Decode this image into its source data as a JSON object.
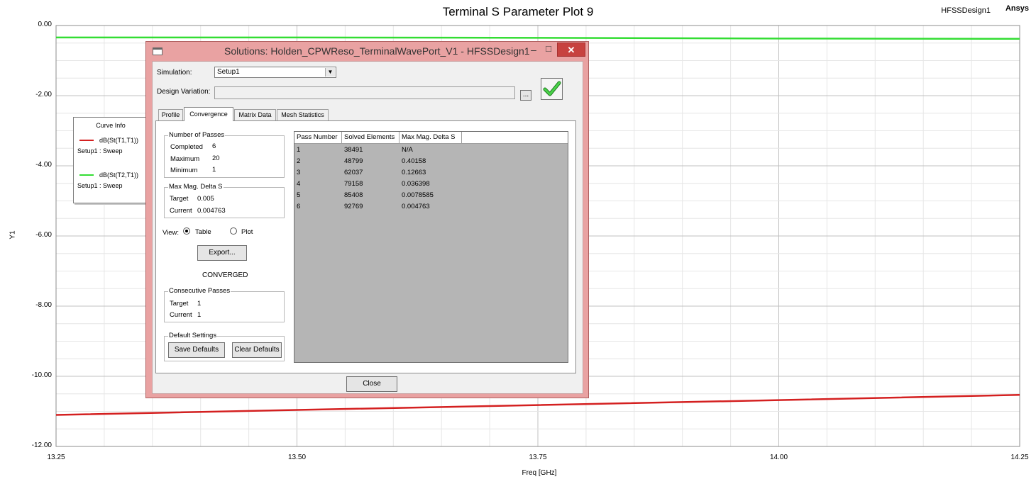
{
  "plot": {
    "title": "Terminal S Parameter Plot 9",
    "design": "HFSSDesign1",
    "brand": "Ansys",
    "xlabel": "Freq [GHz]",
    "ylabel": "Y1"
  },
  "chart_data": {
    "type": "line",
    "title": "Terminal S Parameter Plot 9",
    "xlabel": "Freq [GHz]",
    "ylabel": "Y1",
    "xlim": [
      13.25,
      14.25
    ],
    "ylim": [
      -12.0,
      0.0
    ],
    "x_ticks": [
      "13.25",
      "13.50",
      "13.75",
      "14.00",
      "14.25"
    ],
    "y_ticks": [
      "0.00",
      "-2.00",
      "-4.00",
      "-6.00",
      "-8.00",
      "-10.00",
      "-12.00"
    ],
    "grid": true,
    "legend_title": "Curve Info",
    "legend_placement": "top-left",
    "series": [
      {
        "name": "dB(St(T1,T1))",
        "subtitle": "Setup1 : Sweep",
        "color": "#d42020",
        "x": [
          13.25,
          13.5,
          13.75,
          14.0,
          14.25
        ],
        "y": [
          -11.1,
          -10.96,
          -10.82,
          -10.68,
          -10.53
        ]
      },
      {
        "name": "dB(St(T2,T1))",
        "subtitle": "Setup1 : Sweep",
        "color": "#33dd33",
        "x": [
          13.25,
          13.5,
          13.75,
          14.0,
          14.25
        ],
        "y": [
          -0.34,
          -0.34,
          -0.35,
          -0.37,
          -0.38
        ]
      }
    ]
  },
  "dialog": {
    "title": "Solutions: Holden_CPWReso_TerminalWavePort_V1 - HFSSDesign1",
    "min_glyph": "–",
    "max_glyph": "□",
    "close_glyph": "✕",
    "simulation_label": "Simulation:",
    "simulation_value": "Setup1",
    "design_variation_label": "Design Variation:",
    "browse_label": "...",
    "tabs": [
      "Profile",
      "Convergence",
      "Matrix Data",
      "Mesh Statistics"
    ],
    "passes": {
      "caption": "Number of Passes",
      "completed_label": "Completed",
      "completed": "6",
      "maximum_label": "Maximum",
      "maximum": "20",
      "minimum_label": "Minimum",
      "minimum": "1"
    },
    "delta": {
      "caption": "Max Mag. Delta S",
      "target_label": "Target",
      "target": "0.005",
      "current_label": "Current",
      "current": "0.004763"
    },
    "view": {
      "label": "View:",
      "table": "Table",
      "plot": "Plot"
    },
    "export_label": "Export...",
    "status": "CONVERGED",
    "consecutive": {
      "caption": "Consecutive Passes",
      "target_label": "Target",
      "target": "1",
      "current_label": "Current",
      "current": "1"
    },
    "defaults": {
      "caption": "Default Settings",
      "save": "Save Defaults",
      "clear": "Clear Defaults"
    },
    "table": {
      "columns": [
        "Pass Number",
        "Solved Elements",
        "Max Mag. Delta S"
      ],
      "rows": [
        [
          "1",
          "38491",
          "N/A"
        ],
        [
          "2",
          "48799",
          "0.40158"
        ],
        [
          "3",
          "62037",
          "0.12663"
        ],
        [
          "4",
          "79158",
          "0.036398"
        ],
        [
          "5",
          "85408",
          "0.0078585"
        ],
        [
          "6",
          "92769",
          "0.004763"
        ]
      ]
    },
    "close_label": "Close"
  }
}
